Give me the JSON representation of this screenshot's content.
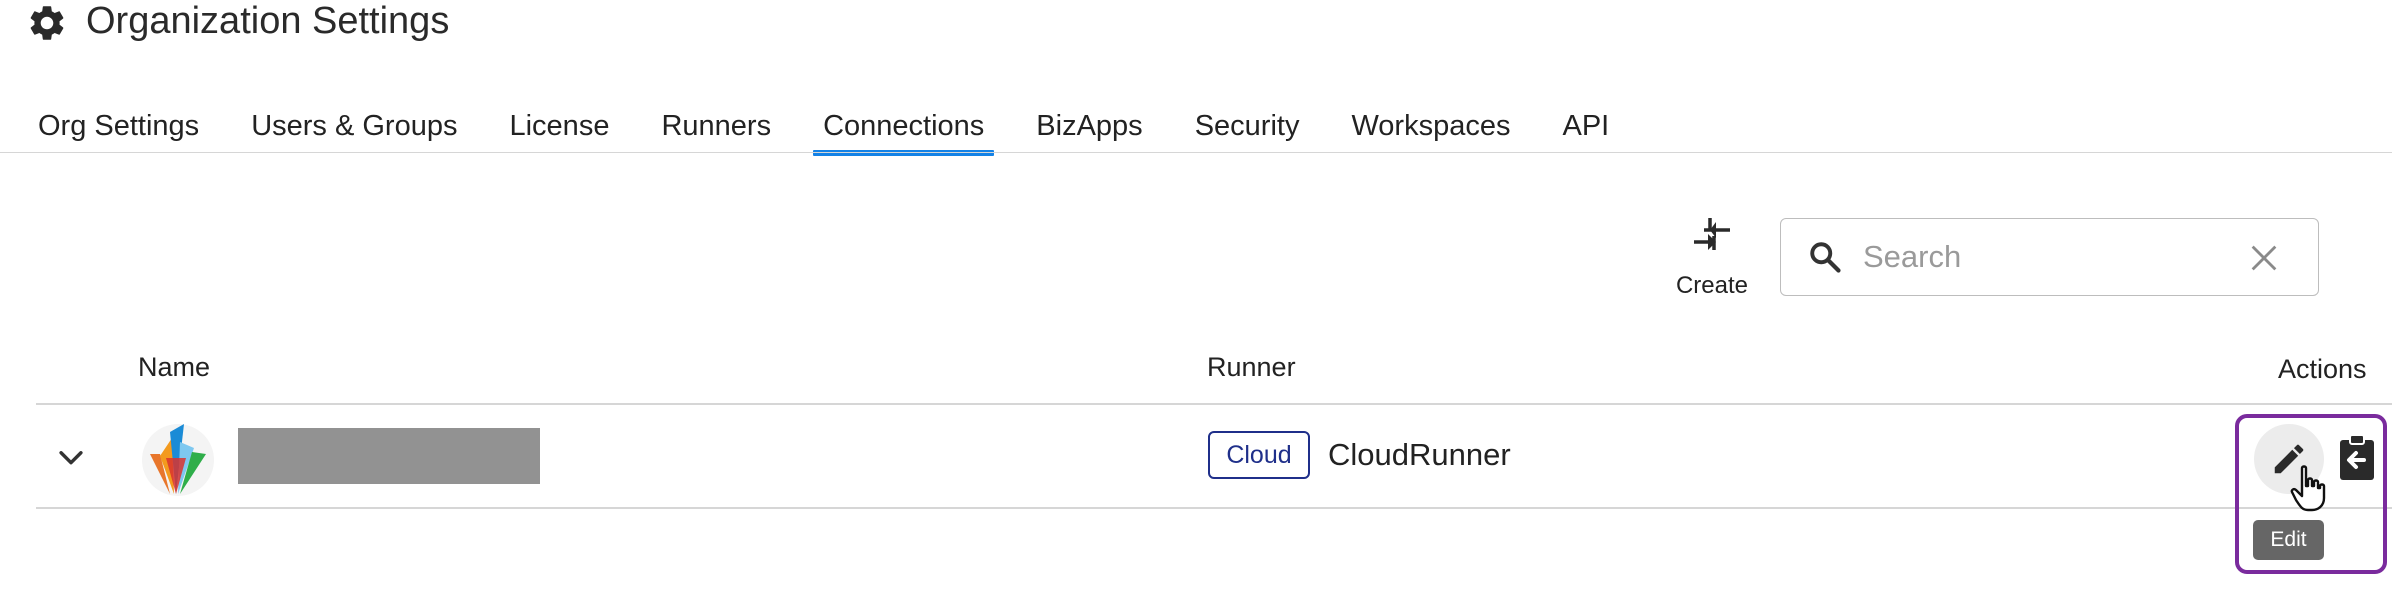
{
  "header": {
    "title": "Organization Settings",
    "icon": "gear-icon"
  },
  "tabs": [
    {
      "label": "Org Settings",
      "active": false
    },
    {
      "label": "Users & Groups",
      "active": false
    },
    {
      "label": "License",
      "active": false
    },
    {
      "label": "Runners",
      "active": false
    },
    {
      "label": "Connections",
      "active": true
    },
    {
      "label": "BizApps",
      "active": false
    },
    {
      "label": "Security",
      "active": false
    },
    {
      "label": "Workspaces",
      "active": false
    },
    {
      "label": "API",
      "active": false
    }
  ],
  "toolbar": {
    "create_label": "Create",
    "create_icon": "connect-arrows-icon"
  },
  "search": {
    "placeholder": "Search",
    "value": ""
  },
  "table": {
    "columns": {
      "name": "Name",
      "runner": "Runner",
      "actions": "Actions"
    },
    "rows": [
      {
        "runner_badge": "Cloud",
        "runner_name": "CloudRunner"
      }
    ]
  },
  "actions": {
    "edit_tooltip": "Edit"
  },
  "colors": {
    "accent": "#1482e6",
    "badge": "#1f2f8a",
    "highlight": "#7a2b9d"
  }
}
